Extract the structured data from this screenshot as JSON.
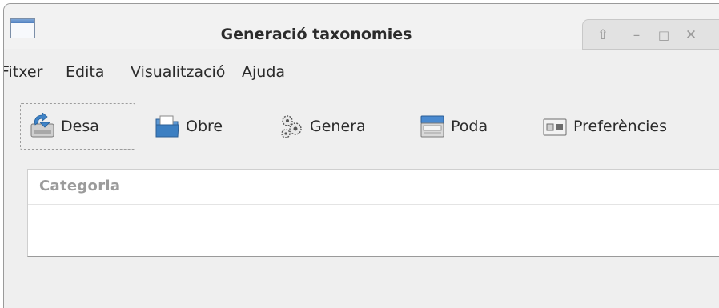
{
  "window": {
    "title": "Generació taxonomies",
    "controls": {
      "shade": "⇧",
      "minimize": "–",
      "maximize": "□",
      "close": "✕"
    }
  },
  "menu": {
    "items": [
      {
        "label": "Fitxer"
      },
      {
        "label": "Edita"
      },
      {
        "label": "Visualització"
      },
      {
        "label": "Ajuda"
      }
    ]
  },
  "toolbar": {
    "items": [
      {
        "label": "Desa",
        "icon": "save-icon"
      },
      {
        "label": "Obre",
        "icon": "open-folder-icon"
      },
      {
        "label": "Genera",
        "icon": "gears-icon"
      },
      {
        "label": "Poda",
        "icon": "prune-icon"
      },
      {
        "label": "Preferències",
        "icon": "preferences-icon"
      }
    ]
  },
  "list": {
    "columns": [
      {
        "label": "Categoria"
      }
    ],
    "rows": []
  },
  "colors": {
    "window_bg": "#efefef",
    "accent_blue": "#4a87c8",
    "header_text": "#9b9b9b"
  }
}
